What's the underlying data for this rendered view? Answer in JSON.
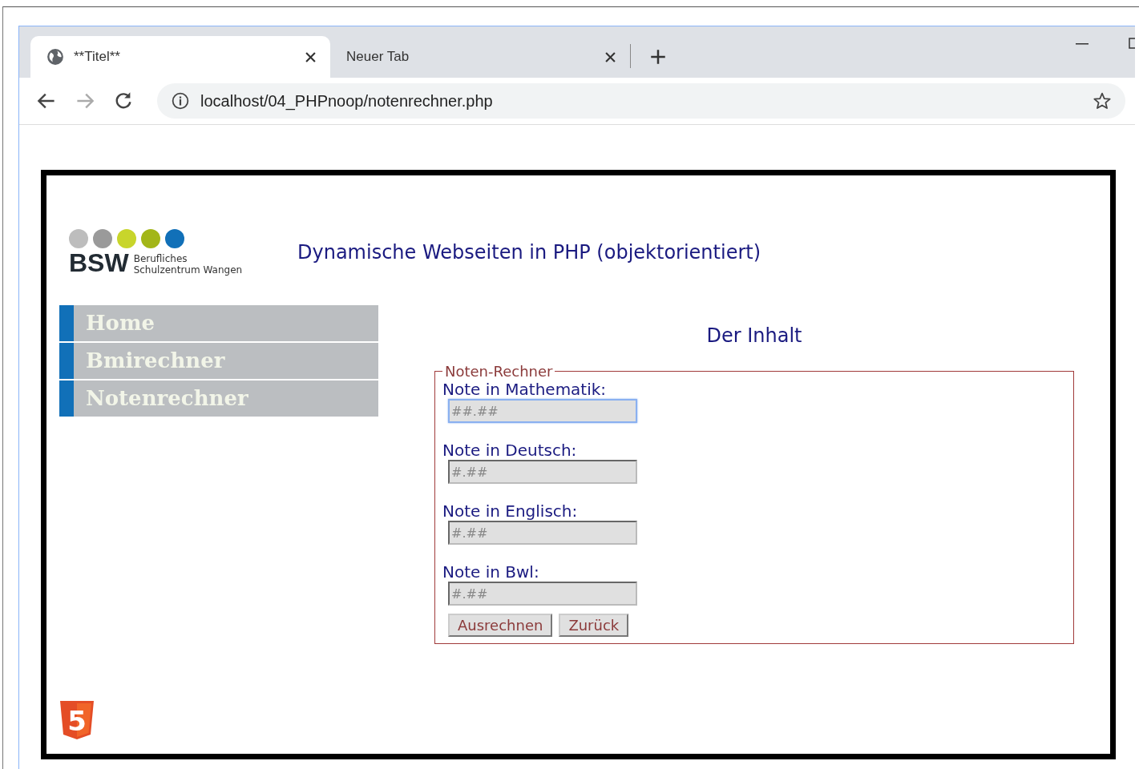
{
  "browser": {
    "tabs": [
      {
        "title": "**Titel**",
        "selected": true
      },
      {
        "title": "Neuer Tab",
        "selected": false
      }
    ],
    "address": "localhost/04_PHPnoop/notenrechner.php"
  },
  "logo": {
    "letters": "BSW",
    "line_1": "Berufliches",
    "line_2": "Schulzentrum Wangen",
    "dots": [
      {
        "color": "#bdbdbd"
      },
      {
        "color": "#9a9a9a"
      },
      {
        "color": "#c8d52b"
      },
      {
        "color": "#a3b618"
      },
      {
        "color": "#1170b8"
      }
    ]
  },
  "page_title": "Dynamische Webseiten in PHP (objektorientiert)",
  "nav": [
    {
      "label": "Home"
    },
    {
      "label": "Bmirechner"
    },
    {
      "label": "Notenrechner"
    }
  ],
  "content_heading": "Der Inhalt",
  "form": {
    "legend": "Noten-Rechner",
    "fields": [
      {
        "label": "Note in Mathematik:",
        "placeholder": "##.##",
        "focused": true
      },
      {
        "label": "Note in Deutsch:",
        "placeholder": "#.##",
        "focused": false
      },
      {
        "label": "Note in Englisch:",
        "placeholder": "#.##",
        "focused": false
      },
      {
        "label": "Note in Bwl:",
        "placeholder": "#.##",
        "focused": false
      }
    ],
    "buttons": [
      "Ausrechnen",
      "Zurück"
    ]
  },
  "footer_badge": "5"
}
